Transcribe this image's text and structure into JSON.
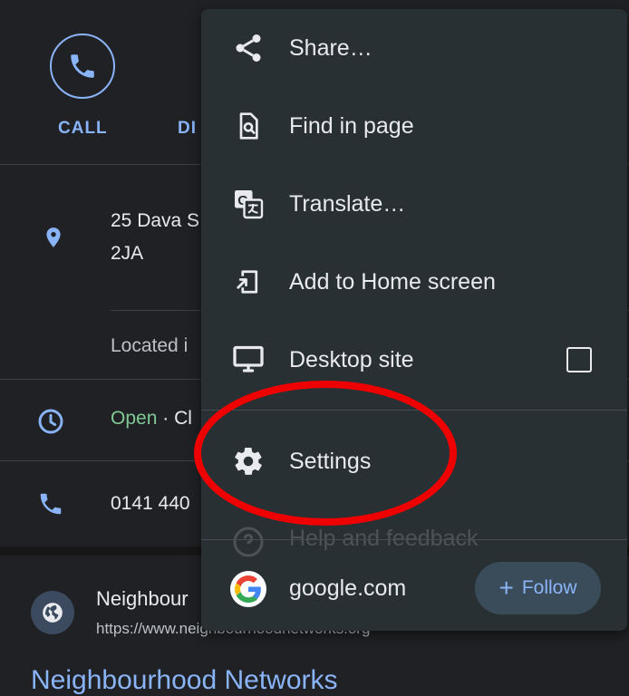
{
  "background": {
    "actions": {
      "call_label": "CALL",
      "directions_label": "DI"
    },
    "address": {
      "line1": "25 Dava S",
      "line2": "2JA",
      "located_in": "Located i"
    },
    "hours": {
      "open_label": "Open",
      "separator": "·",
      "rest": "Cl"
    },
    "phone": {
      "number": "0141 440"
    },
    "website": {
      "name": "Neighbour",
      "url": "https://www.neighbourhoodnetworks.org",
      "result_title": "Neighbourhood Networks"
    }
  },
  "menu": {
    "items": [
      {
        "label": "Share…",
        "icon": "share-icon"
      },
      {
        "label": "Find in page",
        "icon": "find-in-page-icon"
      },
      {
        "label": "Translate…",
        "icon": "translate-icon"
      },
      {
        "label": "Add to Home screen",
        "icon": "add-to-home-screen-icon"
      },
      {
        "label": "Desktop site",
        "icon": "desktop-icon",
        "checked": false
      },
      {
        "label": "Settings",
        "icon": "gear-icon"
      },
      {
        "label": "Help and feedback",
        "icon": "help-icon"
      }
    ],
    "footer": {
      "site": "google.com",
      "follow_plus": "+",
      "follow_label": "Follow"
    }
  },
  "annotation": {
    "color": "#ee0000",
    "target": "Settings"
  },
  "colors": {
    "background": "#202124",
    "menu_background": "#293034",
    "accent_blue": "#8ab4f8",
    "open_green": "#81c995"
  }
}
